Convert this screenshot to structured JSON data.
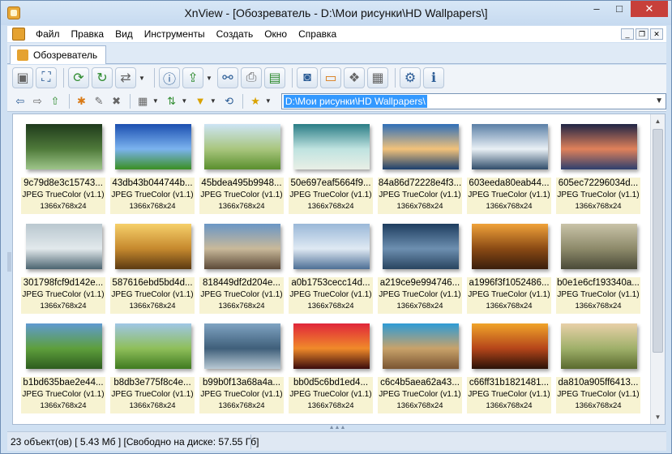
{
  "window": {
    "title": "XnView - [Обозреватель - D:\\Мои рисунки\\HD Wallpapers\\]"
  },
  "titlebar_buttons": {
    "minimize": "–",
    "maximize": "□",
    "close": "✕"
  },
  "menu": {
    "items": [
      "Файл",
      "Правка",
      "Вид",
      "Инструменты",
      "Создать",
      "Окно",
      "Справка"
    ],
    "mdi": {
      "minimize": "_",
      "restore": "❐",
      "close": "✕"
    }
  },
  "tabs": [
    {
      "label": "Обозреватель"
    }
  ],
  "path": {
    "value": "D:\\Мои рисунки\\HD Wallpapers\\"
  },
  "thumbnails": [
    {
      "name": "9c79d8e3c15743...",
      "type": "JPEG TrueColor (v1.1)",
      "size": "1366x768x24",
      "colors": [
        "#1f3a1c",
        "#4f7a3a",
        "#9ec58a"
      ]
    },
    {
      "name": "43db43b044744b...",
      "type": "JPEG TrueColor (v1.1)",
      "size": "1366x768x24",
      "colors": [
        "#1c4fb0",
        "#7bb3ef",
        "#3a8f22"
      ]
    },
    {
      "name": "45bdea495b9948...",
      "type": "JPEG TrueColor (v1.1)",
      "size": "1366x768x24",
      "colors": [
        "#cde4f5",
        "#a9c67e",
        "#5a8f2e"
      ]
    },
    {
      "name": "50e697eaf5664f9...",
      "type": "JPEG TrueColor (v1.1)",
      "size": "1366x768x24",
      "colors": [
        "#2a7d86",
        "#bfe3e0",
        "#e9efe6"
      ]
    },
    {
      "name": "84a86d72228e4f3...",
      "type": "JPEG TrueColor (v1.1)",
      "size": "1366x768x24",
      "colors": [
        "#2f6fb8",
        "#f2c27a",
        "#1b3f6e"
      ]
    },
    {
      "name": "603eeda80eab44...",
      "type": "JPEG TrueColor (v1.1)",
      "size": "1366x768x24",
      "colors": [
        "#5a7fa6",
        "#e9f0f5",
        "#2f4c6a"
      ]
    },
    {
      "name": "605ec72296034d...",
      "type": "JPEG TrueColor (v1.1)",
      "size": "1366x768x24",
      "colors": [
        "#1f2545",
        "#e0815a",
        "#2d3f6e"
      ]
    },
    {
      "name": "301798fcf9d142e...",
      "type": "JPEG TrueColor (v1.1)",
      "size": "1366x768x24",
      "colors": [
        "#b9c7cf",
        "#e2e9ec",
        "#4b6470"
      ]
    },
    {
      "name": "587616ebd5bd4d...",
      "type": "JPEG TrueColor (v1.1)",
      "size": "1366x768x24",
      "colors": [
        "#f6d06a",
        "#c6892e",
        "#5c3a12"
      ]
    },
    {
      "name": "818449df2d204e...",
      "type": "JPEG TrueColor (v1.1)",
      "size": "1366x768x24",
      "colors": [
        "#6a96c6",
        "#c9b99a",
        "#5c4a38"
      ]
    },
    {
      "name": "a0b1753cecc14d...",
      "type": "JPEG TrueColor (v1.1)",
      "size": "1366x768x24",
      "colors": [
        "#9ab8d8",
        "#dfe9f3",
        "#4d6f95"
      ]
    },
    {
      "name": "a219ce9e994746...",
      "type": "JPEG TrueColor (v1.1)",
      "size": "1366x768x24",
      "colors": [
        "#1e3d5f",
        "#6d8fb0",
        "#28445f"
      ]
    },
    {
      "name": "a1996f3f1052486...",
      "type": "JPEG TrueColor (v1.1)",
      "size": "1366x768x24",
      "colors": [
        "#f0a23a",
        "#8a4a14",
        "#3a1e0c"
      ]
    },
    {
      "name": "b0e1e6cf193340a...",
      "type": "JPEG TrueColor (v1.1)",
      "size": "1366x768x24",
      "colors": [
        "#c9c3a8",
        "#8d8a6a",
        "#4a4a38"
      ]
    },
    {
      "name": "b1bd635bae2e44...",
      "type": "JPEG TrueColor (v1.1)",
      "size": "1366x768x24",
      "colors": [
        "#5f9ad1",
        "#5e9f3c",
        "#2d5c1e"
      ]
    },
    {
      "name": "b8db3e775f8c4e...",
      "type": "JPEG TrueColor (v1.1)",
      "size": "1366x768x24",
      "colors": [
        "#9fc6e6",
        "#8fbf5a",
        "#3f7a20"
      ]
    },
    {
      "name": "b99b0f13a68a4a...",
      "type": "JPEG TrueColor (v1.1)",
      "size": "1366x768x24",
      "colors": [
        "#7fa3c2",
        "#3f5f7a",
        "#b8c9d4"
      ]
    },
    {
      "name": "bb0d5c6bd1ed4...",
      "type": "JPEG TrueColor (v1.1)",
      "size": "1366x768x24",
      "colors": [
        "#e0263a",
        "#f08a2a",
        "#3a0c0c"
      ]
    },
    {
      "name": "c6c4b5aea62a43...",
      "type": "JPEG TrueColor (v1.1)",
      "size": "1366x768x24",
      "colors": [
        "#2d9bd6",
        "#c8a26a",
        "#7a5532"
      ]
    },
    {
      "name": "c66ff31b1821481...",
      "type": "JPEG TrueColor (v1.1)",
      "size": "1366x768x24",
      "colors": [
        "#f0a42a",
        "#b5451a",
        "#2a1208"
      ]
    },
    {
      "name": "da810a905ff6413...",
      "type": "JPEG TrueColor (v1.1)",
      "size": "1366x768x24",
      "colors": [
        "#e8d0a8",
        "#9fb06a",
        "#5a6a2e"
      ]
    }
  ],
  "status": {
    "text": "23 объект(ов) [ 5.43 Мб ] [Свободно на диске: 57.55 Гб]"
  }
}
